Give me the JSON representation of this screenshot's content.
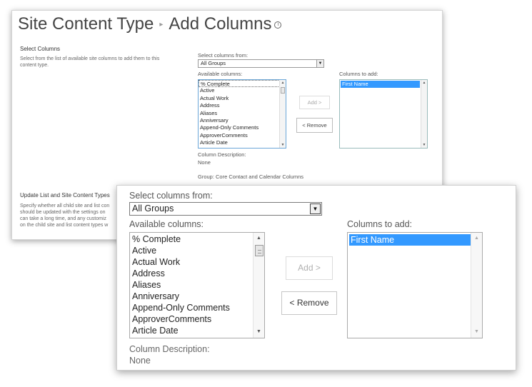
{
  "header": {
    "site_label": "Site Content Type",
    "separator": "▸",
    "page_title": "Add Columns",
    "info_glyph": "i"
  },
  "sections": {
    "select_columns": {
      "title": "Select Columns",
      "description": "Select from the list of available site columns to add them to this content type."
    },
    "update_list": {
      "title": "Update List and Site Content Types",
      "description_lines": [
        "Specify whether all child site and list con",
        "should be updated with the settings on",
        "can take a long time, and any customiz",
        "on the child site and list content types w"
      ]
    }
  },
  "form": {
    "select_from_label": "Select columns from:",
    "select_from_value": "All Groups",
    "available_label": "Available columns:",
    "available_items": [
      "% Complete",
      "Active",
      "Actual Work",
      "Address",
      "Aliases",
      "Anniversary",
      "Append-Only Comments",
      "ApproverComments",
      "Article Date"
    ],
    "columns_to_add_label": "Columns to add:",
    "columns_to_add_items": [
      "First Name"
    ],
    "add_button": "Add >",
    "remove_button": "< Remove",
    "column_description_label": "Column Description:",
    "column_description_value": "None",
    "group_text": "Group: Core Contact and Calendar Columns"
  },
  "colors": {
    "selection": "#3399ff",
    "focus_border": "#6aa6d8"
  }
}
